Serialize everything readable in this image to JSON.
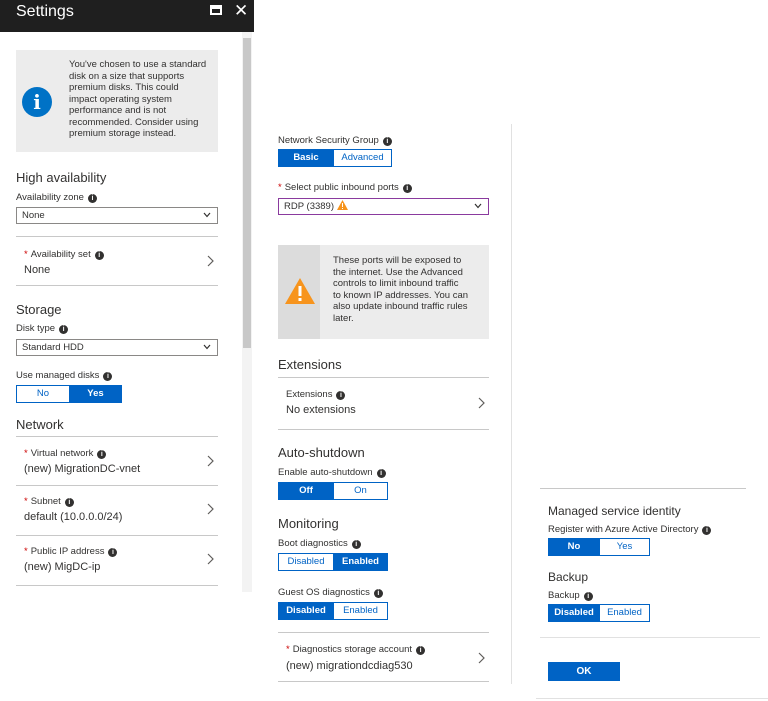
{
  "left": {
    "title": "Settings",
    "notice": [
      "You've chosen to use a standard",
      "disk on a size that supports",
      "premium disks. This could",
      "impact operating system",
      "performance and is not",
      "recommended. Consider using",
      "premium storage instead."
    ],
    "high_availability": {
      "heading": "High availability",
      "zone_label": "Availability zone",
      "zone_value": "None",
      "set_label": "Availability set",
      "set_value": "None"
    },
    "storage": {
      "heading": "Storage",
      "disk_type_label": "Disk type",
      "disk_type_value": "Standard HDD",
      "managed_label": "Use managed disks",
      "managed_options": [
        "No",
        "Yes"
      ],
      "managed_selected": "Yes"
    },
    "network": {
      "heading": "Network",
      "vnet_label": "Virtual network",
      "vnet_value": "(new) MigrationDC-vnet",
      "subnet_label": "Subnet",
      "subnet_value": "default (10.0.0.0/24)",
      "pip_label": "Public IP address",
      "pip_value": "(new) MigDC-ip"
    }
  },
  "middle": {
    "nsg_label": "Network Security Group",
    "nsg_options": [
      "Basic",
      "Advanced"
    ],
    "nsg_selected": "Basic",
    "ports_label": "Select public inbound ports",
    "ports_value": "RDP (3389)",
    "ports_warning": [
      "These ports will be exposed to",
      "the internet. Use the Advanced",
      "controls to limit inbound traffic",
      "to known IP addresses. You can",
      "also update inbound traffic rules",
      "later."
    ],
    "extensions": {
      "heading": "Extensions",
      "label": "Extensions",
      "value": "No extensions"
    },
    "auto_shutdown": {
      "heading": "Auto-shutdown",
      "label": "Enable auto-shutdown",
      "options": [
        "Off",
        "On"
      ],
      "selected": "Off"
    },
    "monitoring": {
      "heading": "Monitoring",
      "boot_label": "Boot diagnostics",
      "boot_options": [
        "Disabled",
        "Enabled"
      ],
      "boot_selected": "Enabled",
      "guest_label": "Guest OS diagnostics",
      "guest_options": [
        "Disabled",
        "Enabled"
      ],
      "guest_selected": "Disabled",
      "storage_label": "Diagnostics storage account",
      "storage_value": "(new) migrationdcdiag530"
    }
  },
  "right": {
    "msi_heading": "Managed service identity",
    "msi_label": "Register with Azure Active Directory",
    "msi_options": [
      "No",
      "Yes"
    ],
    "msi_selected": "No",
    "backup_heading": "Backup",
    "backup_label": "Backup",
    "backup_options": [
      "Disabled",
      "Enabled"
    ],
    "backup_selected": "Disabled",
    "ok_label": "OK"
  },
  "colors": {
    "accent": "#0063c5",
    "info": "#0072c6",
    "warning": "#f7941d",
    "titlebar": "#1f1f1f"
  }
}
